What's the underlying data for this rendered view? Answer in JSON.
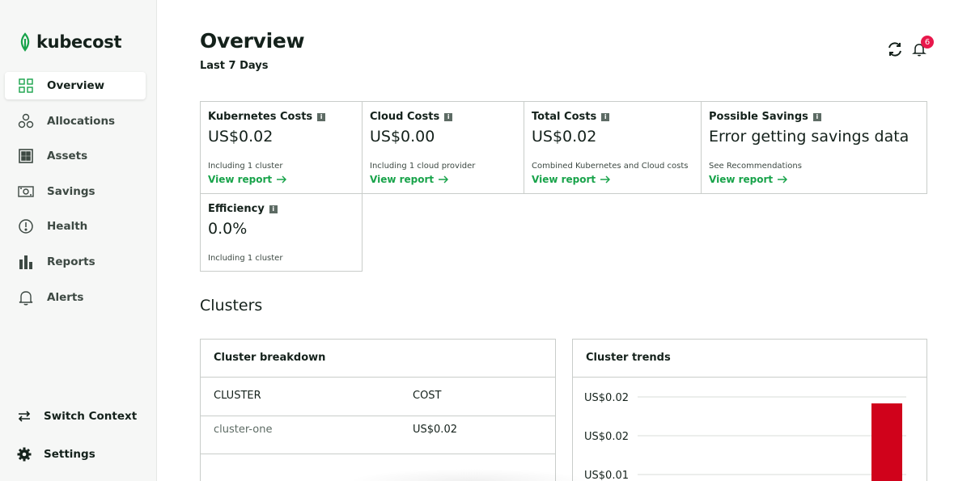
{
  "app": {
    "name": "kubecost",
    "brand_color": "#18a34a",
    "alert_color": "#e8174b",
    "chart_bar_color": "#d0021b"
  },
  "sidebar": {
    "items": [
      {
        "label": "Overview",
        "icon": "grid-icon",
        "active": true
      },
      {
        "label": "Allocations",
        "icon": "allocations-icon",
        "active": false
      },
      {
        "label": "Assets",
        "icon": "assets-icon",
        "active": false
      },
      {
        "label": "Savings",
        "icon": "savings-icon",
        "active": false
      },
      {
        "label": "Health",
        "icon": "health-icon",
        "active": false
      },
      {
        "label": "Reports",
        "icon": "reports-icon",
        "active": false
      },
      {
        "label": "Alerts",
        "icon": "bell-icon",
        "active": false
      }
    ],
    "switch_context": "Switch Context",
    "settings": "Settings"
  },
  "header": {
    "title": "Overview",
    "subtitle": "Last 7 Days",
    "notification_count": "6"
  },
  "cards": [
    {
      "title": "Kubernetes Costs",
      "value": "US$0.02",
      "note": "Including 1 cluster",
      "link": "View report"
    },
    {
      "title": "Cloud Costs",
      "value": "US$0.00",
      "note": "Including 1 cloud provider",
      "link": "View report"
    },
    {
      "title": "Total Costs",
      "value": "US$0.02",
      "note": "Combined Kubernetes and Cloud costs",
      "link": "View report"
    },
    {
      "title": "Possible Savings",
      "value": "Error getting savings data",
      "note": "See Recommendations",
      "link": "View report"
    },
    {
      "title": "Efficiency",
      "value": "0.0%",
      "note": "Including 1 cluster"
    }
  ],
  "clusters": {
    "title": "Clusters",
    "breakdown": {
      "title": "Cluster breakdown",
      "columns": [
        "CLUSTER",
        "COST"
      ],
      "rows": [
        {
          "cluster": "cluster-one",
          "cost": "US$0.02"
        }
      ]
    },
    "trends": {
      "title": "Cluster trends"
    }
  },
  "chart_data": {
    "type": "bar",
    "title": "Cluster trends",
    "ytick_labels": [
      "US$0.02",
      "US$0.02",
      "US$0.01"
    ],
    "ylim": [
      0.01,
      0.02
    ],
    "series": [
      {
        "values": [
          0.02
        ]
      }
    ],
    "grid": true
  }
}
